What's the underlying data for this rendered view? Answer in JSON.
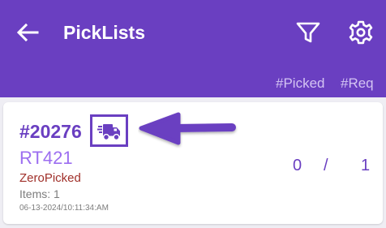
{
  "header": {
    "title": "PickLists",
    "back_icon": "arrow-left-icon",
    "filter_icon": "filter-icon",
    "settings_icon": "gear-icon"
  },
  "columns": {
    "picked": "#Picked",
    "required": "#Req"
  },
  "picklist": {
    "order_number": "#20276",
    "shipping_icon": "shipping-truck-icon",
    "route": "RT421",
    "status": "ZeroPicked",
    "items": "Items: 1",
    "timestamp": "06-13-2024/10:11:34:AM",
    "picked_count": "0",
    "separator": "/",
    "required_count": "1"
  },
  "colors": {
    "primary": "#6a3fc1",
    "route": "#9c6ef0",
    "status": "#a0302a",
    "muted": "#7d7d7d",
    "background": "#efeef4"
  }
}
